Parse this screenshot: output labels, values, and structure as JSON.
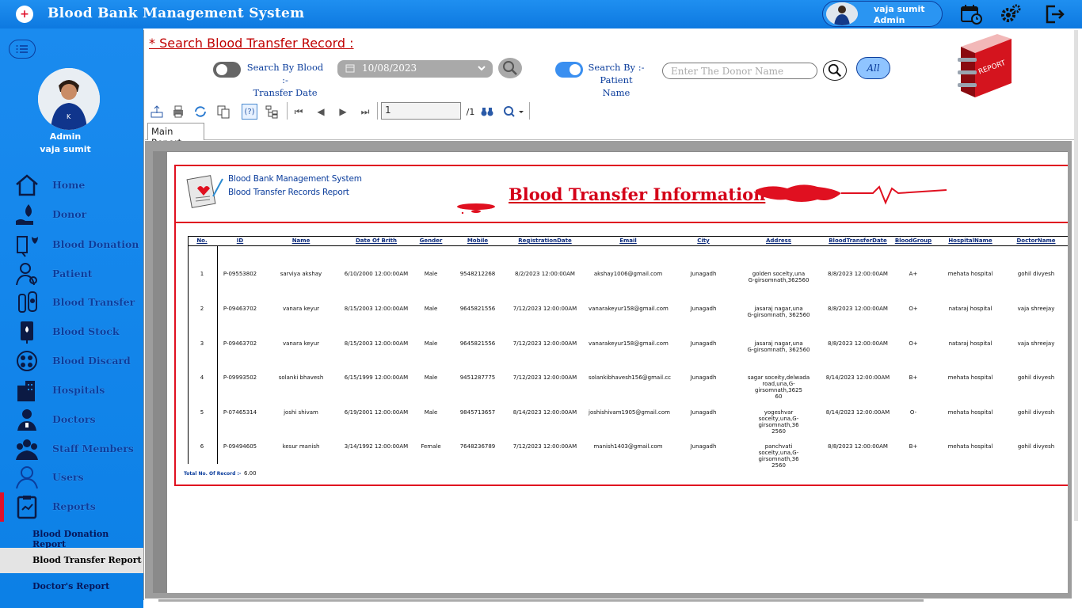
{
  "app": {
    "title": "Blood Bank Management System",
    "user_name": "vaja sumit",
    "user_role": "Admin"
  },
  "sidebar": {
    "role": "Admin",
    "name": "vaja sumit",
    "items": [
      {
        "label": "Home",
        "icon": "home-icon"
      },
      {
        "label": "Donor",
        "icon": "donor-icon"
      },
      {
        "label": "Blood Donation",
        "icon": "blood-donation-icon"
      },
      {
        "label": "Patient",
        "icon": "patient-icon"
      },
      {
        "label": "Blood Transfer",
        "icon": "blood-transfer-icon"
      },
      {
        "label": "Blood Stock",
        "icon": "blood-stock-icon"
      },
      {
        "label": "Blood Discard",
        "icon": "blood-discard-icon"
      },
      {
        "label": "Hospitals",
        "icon": "hospitals-icon"
      },
      {
        "label": "Doctors",
        "icon": "doctors-icon"
      },
      {
        "label": "Staff Members",
        "icon": "staff-icon"
      },
      {
        "label": "Users",
        "icon": "users-icon"
      },
      {
        "label": "Reports",
        "icon": "reports-icon"
      }
    ],
    "subitems": [
      "Blood Donation Report",
      "Blood Transfer Report",
      "Doctor's  Report"
    ],
    "active_sub": "Blood Transfer Report"
  },
  "search": {
    "title": "*  Search Blood Transfer Record  :",
    "by_date_label_1": "Search By Blood  :-",
    "by_date_label_2": "Transfer Date",
    "date_value": "10/08/2023",
    "by_patient_label_1": "Search By  :-",
    "by_patient_label_2": "Patient Name",
    "donor_placeholder": "Enter The Donor Name",
    "all_label": "All",
    "date_toggle_on": false,
    "patient_toggle_on": true,
    "report_badge_text": "REPORT"
  },
  "viewer": {
    "page_value": "1",
    "page_total": "/1",
    "tab_label": "Main Report"
  },
  "report": {
    "header_line1": "Blood Bank Management System",
    "header_line2": "Blood Transfer Records Report",
    "title": "Blood Transfer Information",
    "columns": [
      "No.",
      "ID",
      "Name",
      "Date Of Brith",
      "Gender",
      "Mobile",
      "RegistrationDate",
      "Email",
      "City",
      "Address",
      "BloodTransferDate",
      "BloodGroup",
      "HospitalName",
      "DoctorName"
    ],
    "rows": [
      [
        "1",
        "P-09553802",
        "sarviya akshay",
        "6/10/2000  12:00:00AM",
        "Male",
        "9548212268",
        "8/2/2023  12:00:00AM",
        "akshay1006@gmail.com",
        "Junagadh",
        "golden socelty,una\nG-girsomnath,362560",
        "8/8/2023  12:00:00AM",
        "A+",
        "mehata hospital",
        "gohil divyesh"
      ],
      [
        "2",
        "P-09463702",
        "vanara keyur",
        "8/15/2003  12:00:00AM",
        "Male",
        "9645821556",
        "7/12/2023  12:00:00AM",
        "vanarakeyur158@gmail.com",
        "Junagadh",
        "jasaraj nagar,una\nG-girsomnath, 362560",
        "8/8/2023  12:00:00AM",
        "O+",
        "nataraj hospital",
        "vaja shreejay"
      ],
      [
        "3",
        "P-09463702",
        "vanara keyur",
        "8/15/2003  12:00:00AM",
        "Male",
        "9645821556",
        "7/12/2023  12:00:00AM",
        "vanarakeyur158@gmail.com",
        "Junagadh",
        "jasaraj nagar,una\nG-girsomnath, 362560",
        "8/8/2023  12:00:00AM",
        "O+",
        "nataraj hospital",
        "vaja shreejay"
      ],
      [
        "4",
        "P-09993502",
        "solanki bhavesh",
        "6/15/1999  12:00:00AM",
        "Male",
        "9451287775",
        "7/12/2023  12:00:00AM",
        "solankibhavesh156@gmail.cc",
        "Junagadh",
        "sagar soceity,delwada\nroad,una,G-girsomnath,3625\n60",
        "8/14/2023  12:00:00AM",
        "B+",
        "mehata hospital",
        "gohil divyesh"
      ],
      [
        "5",
        "P-07465314",
        "joshi shivam",
        "6/19/2001  12:00:00AM",
        "Male",
        "9845713657",
        "8/14/2023  12:00:00AM",
        "joshishivam1905@gmail.com",
        "Junagadh",
        "yogeshvar\nsocelty,una,G-girsomnath,36\n2560",
        "8/14/2023  12:00:00AM",
        "O-",
        "mehata hospital",
        "gohil divyesh"
      ],
      [
        "6",
        "P-09494605",
        "kesur manish",
        "3/14/1992  12:00:00AM",
        "Female",
        "7648236789",
        "7/12/2023  12:00:00AM",
        "manish1403@gmail.com",
        "Junagadh",
        "panchvati\nsocelty,una,G-girsomnath,36\n2560",
        "8/8/2023  12:00:00AM",
        "B+",
        "mehata hospital",
        "gohil divyesh"
      ]
    ],
    "total_label": "Total No. Of Record  :-",
    "total_value": "6.00"
  },
  "colors": {
    "topbar": "#1f8ff0",
    "sidebar": "#1a8bef",
    "accent_red": "#e01020",
    "nav_text": "#0b3d9c"
  }
}
